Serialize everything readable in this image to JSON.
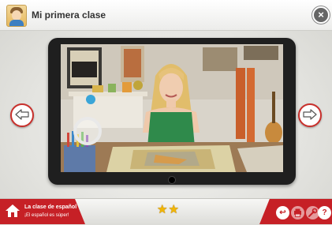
{
  "header": {
    "title": "Mi primera clase"
  },
  "footer": {
    "brand_title": "La clase de español",
    "brand_subtitle": "¡El español es súper!",
    "stars_earned": 2
  },
  "icons": {
    "close": "×",
    "help": "?",
    "back": "↩"
  },
  "colors": {
    "brand_red": "#c62026",
    "star_gold": "#f2b705"
  }
}
